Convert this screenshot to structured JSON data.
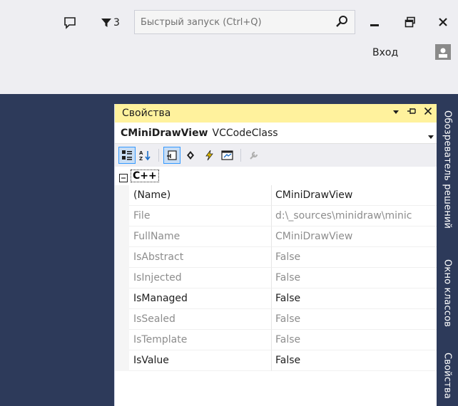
{
  "titlebar": {
    "filter_count": "3",
    "quick_launch_placeholder": "Быстрый запуск (Ctrl+Q)",
    "sign_in": "Вход"
  },
  "side_tabs": [
    {
      "label": "Обозреватель решений"
    },
    {
      "label": "Окно классов"
    },
    {
      "label": "Свойства"
    }
  ],
  "panel": {
    "title": "Свойства",
    "object_name": "CMiniDrawView",
    "object_type": "VCCodeClass",
    "category": "C++",
    "rows": [
      {
        "name": "(Name)",
        "value": "CMiniDrawView"
      },
      {
        "name": "File",
        "value": "d:\\_sources\\minidraw\\minic"
      },
      {
        "name": "FullName",
        "value": "CMiniDrawView"
      },
      {
        "name": "IsAbstract",
        "value": "False"
      },
      {
        "name": "IsInjected",
        "value": "False"
      },
      {
        "name": "IsManaged",
        "value": "False"
      },
      {
        "name": "IsSealed",
        "value": "False"
      },
      {
        "name": "IsTemplate",
        "value": "False"
      },
      {
        "name": "IsValue",
        "value": "False"
      }
    ]
  },
  "colors": {
    "chrome": "#eeeef2",
    "dark_background": "#2d3a5a",
    "panel_title_active": "#fff29d",
    "selected_toolbar_button": "#c9def5",
    "readonly_text": "#8d8d8d",
    "text": "#1e1e1e"
  },
  "icons": {
    "notifications": "speech-bubble-icon",
    "filter": "funnel-icon",
    "search": "magnifier-icon",
    "minimize": "minimize-icon",
    "restore": "restore-icon",
    "close": "close-icon",
    "account": "person-icon",
    "panel_dropdown": "triangle-down-icon",
    "panel_pin": "pin-icon",
    "panel_close": "close-icon",
    "toolbar": [
      "categorized-icon",
      "alphabetical-icon",
      "properties-icon",
      "events-icon",
      "lightning-icon",
      "property-pages-icon",
      "wrench-icon"
    ]
  }
}
